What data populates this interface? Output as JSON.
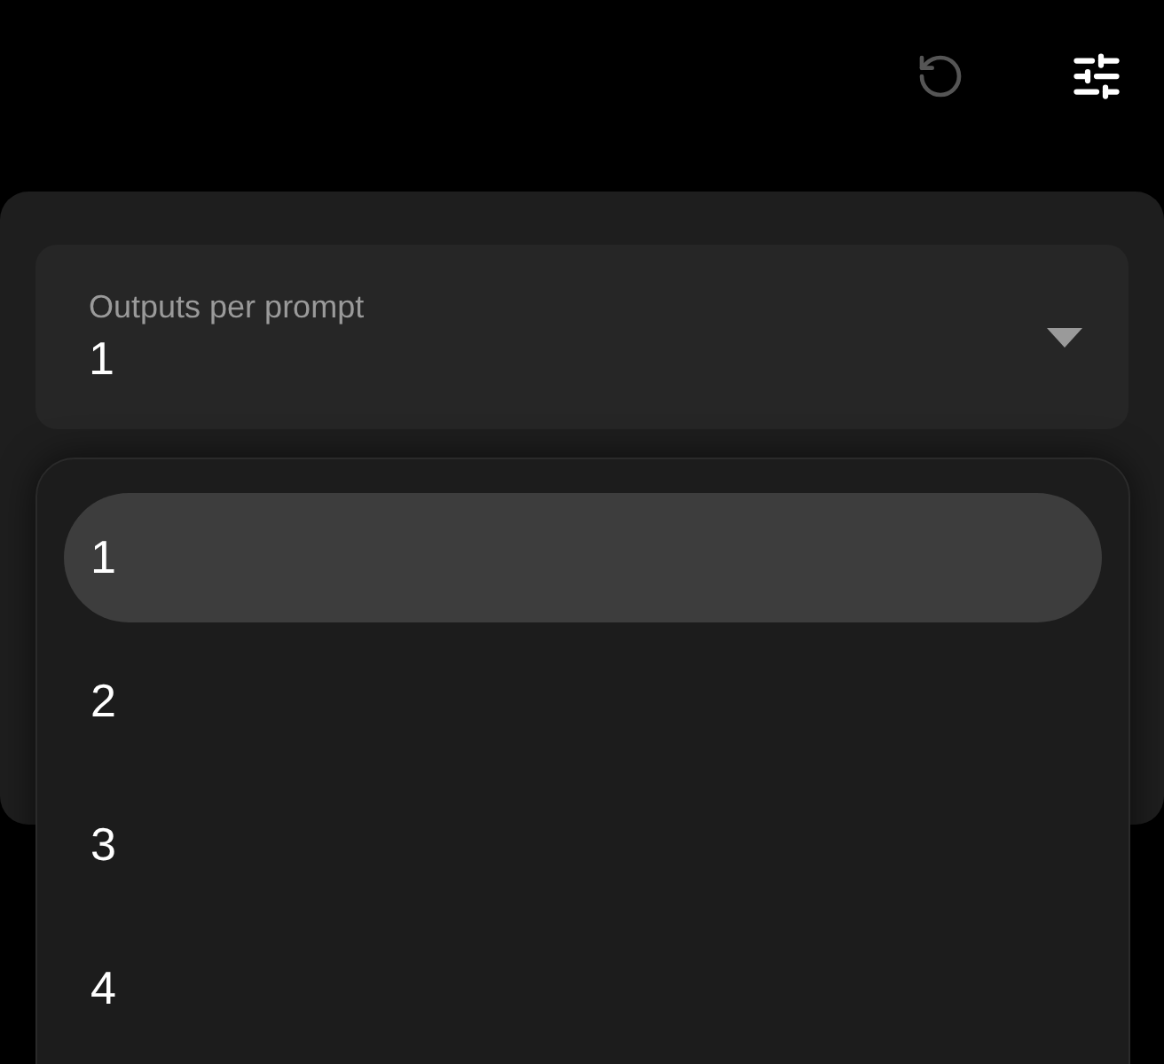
{
  "toolbar": [
    {
      "kind": "refresh"
    },
    {
      "kind": "settings"
    }
  ],
  "select": {
    "label": "Outputs per prompt",
    "value": "1",
    "expanded": true
  },
  "options": [
    {
      "label": "1",
      "selected": true
    },
    {
      "label": "2",
      "selected": false
    },
    {
      "label": "3",
      "selected": false
    },
    {
      "label": "4",
      "selected": false
    }
  ]
}
